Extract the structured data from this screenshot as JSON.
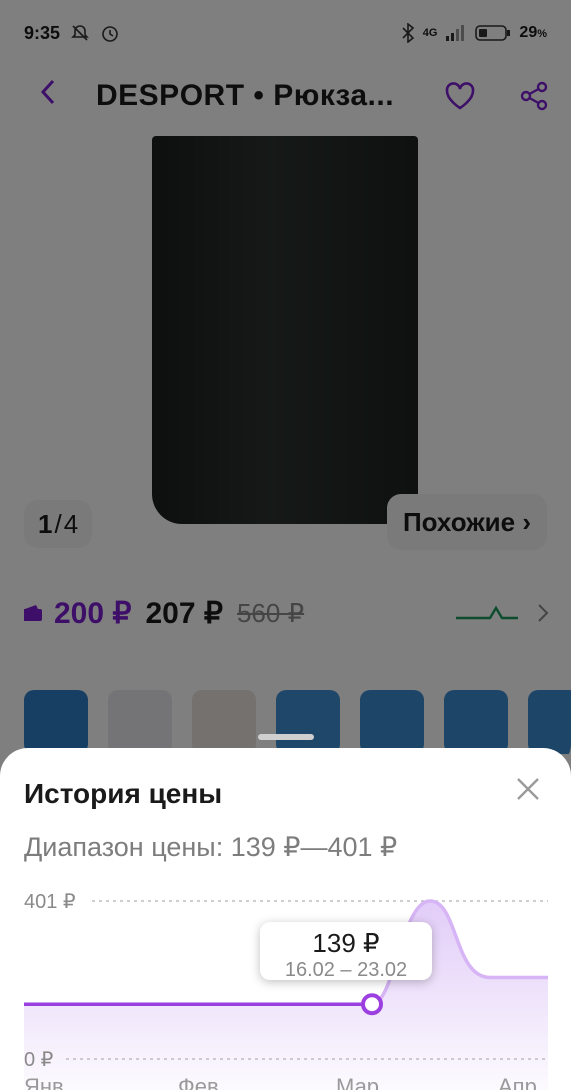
{
  "status": {
    "time": "9:35",
    "network": "4G",
    "battery": "29",
    "battery_unit": "%"
  },
  "header": {
    "title": "DESPORT • Рюкза...",
    "back_icon": "chevron-left-icon",
    "fav_icon": "heart-icon",
    "share_icon": "share-icon"
  },
  "gallery": {
    "current": "1",
    "sep": "/",
    "total": "4",
    "similar": "Похожие ›"
  },
  "prices": {
    "card": "200 ₽",
    "regular": "207 ₽",
    "old": "560 ₽"
  },
  "price_history": {
    "title": "История цены",
    "range_label": "Диапазон цены: 139 ₽—401 ₽",
    "tooltip_value": "139 ₽",
    "tooltip_dates": "16.02 – 23.02",
    "y_top": "401 ₽",
    "y_bottom": "0 ₽",
    "months": [
      "Янв",
      "Фев",
      "Мар",
      "Апр"
    ],
    "accent": "#7b1fd1"
  },
  "chart_data": {
    "type": "line",
    "x": [
      "Янв",
      "Фев",
      "Мар",
      "Апр"
    ],
    "series": [
      {
        "values": [
          139,
          139,
          139,
          401,
          207
        ]
      }
    ],
    "ylim": [
      0,
      401
    ]
  }
}
